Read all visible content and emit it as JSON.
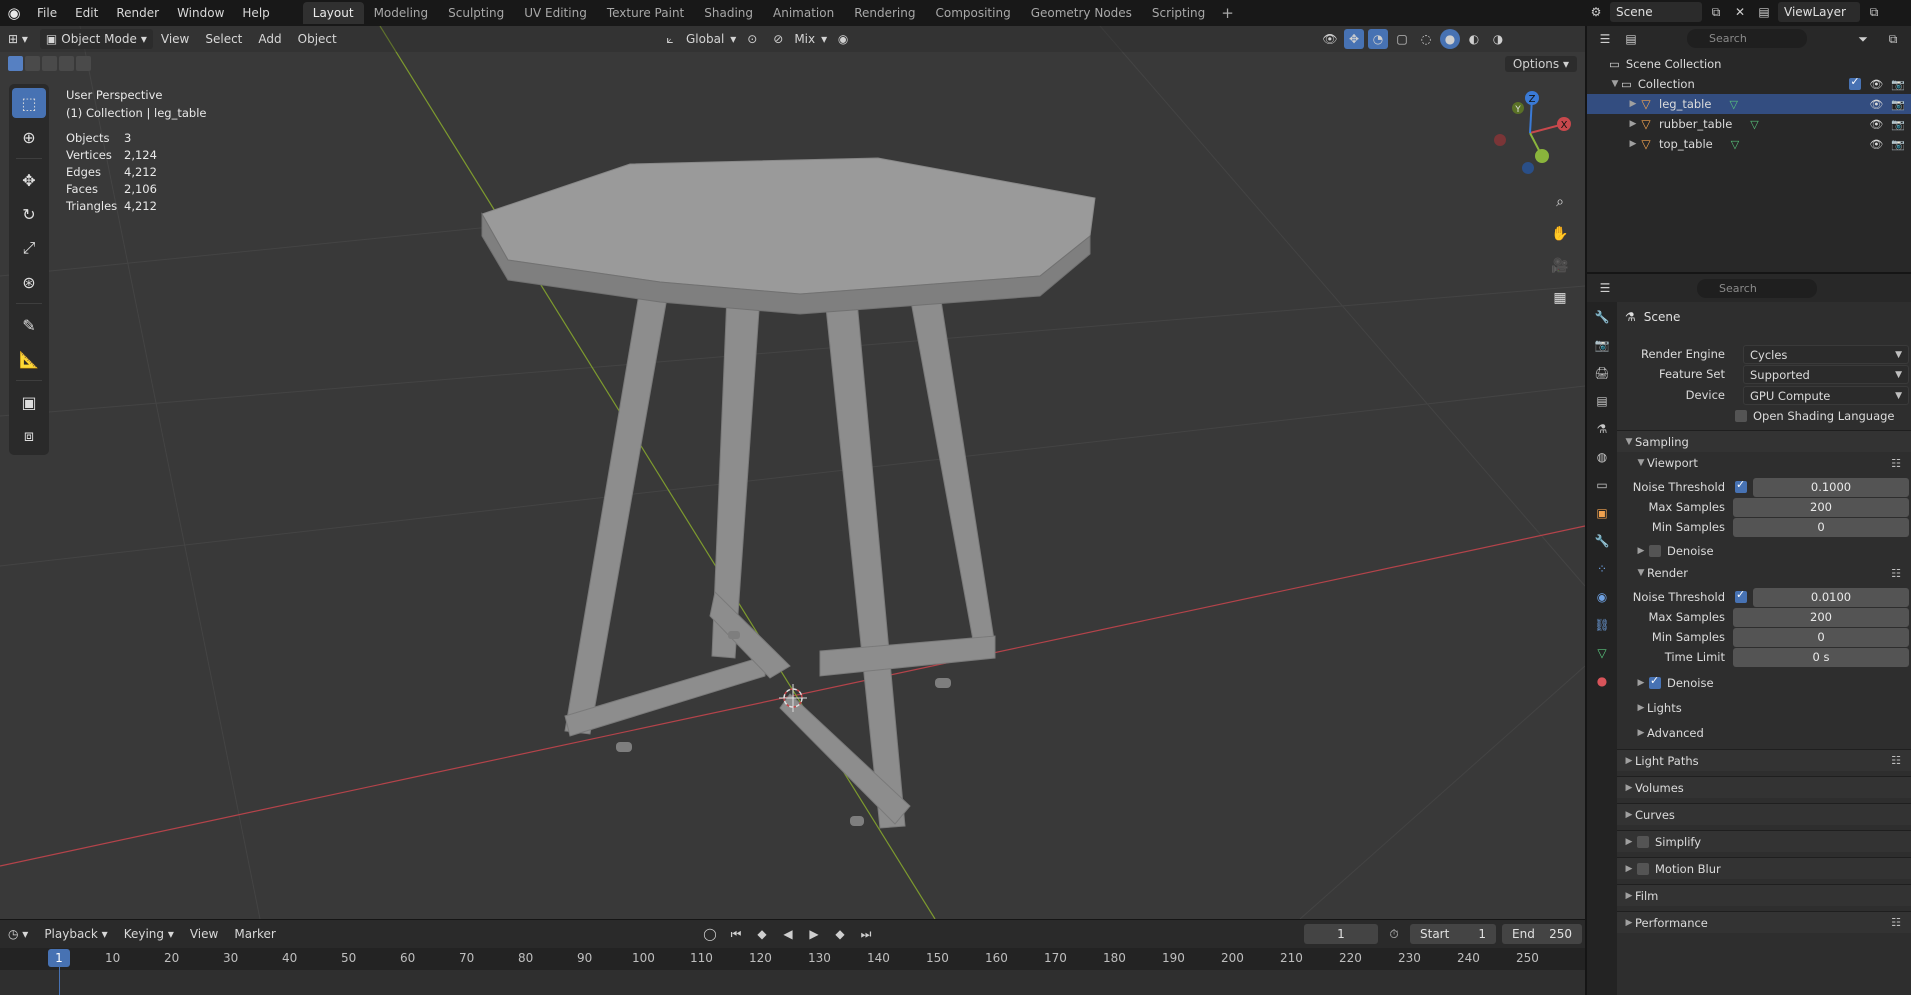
{
  "topbar": {
    "menu": [
      "File",
      "Edit",
      "Render",
      "Window",
      "Help"
    ],
    "workspaces": [
      "Layout",
      "Modeling",
      "Sculpting",
      "UV Editing",
      "Texture Paint",
      "Shading",
      "Animation",
      "Rendering",
      "Compositing",
      "Geometry Nodes",
      "Scripting"
    ],
    "active_workspace": "Layout",
    "add_tab": "+",
    "scene": "Scene",
    "view_layer": "ViewLayer"
  },
  "viewport": {
    "mode": "Object Mode",
    "menu": [
      "View",
      "Select",
      "Add",
      "Object"
    ],
    "transform_orientation": "Global",
    "proportional": "Mix",
    "options": "Options",
    "overlay_title": "User Perspective",
    "overlay_collection": "(1) Collection | leg_table",
    "stats": [
      {
        "label": "Objects",
        "value": "3"
      },
      {
        "label": "Vertices",
        "value": "2,124"
      },
      {
        "label": "Edges",
        "value": "4,212"
      },
      {
        "label": "Faces",
        "value": "2,106"
      },
      {
        "label": "Triangles",
        "value": "4,212"
      }
    ],
    "gizmo": {
      "x": "X",
      "y": "Y",
      "z": "Z"
    }
  },
  "timeline": {
    "menu": [
      "Playback",
      "Keying",
      "View",
      "Marker"
    ],
    "current_frame": "1",
    "start_label": "Start",
    "start": "1",
    "end_label": "End",
    "end": "250",
    "ruler": [
      "10",
      "20",
      "30",
      "40",
      "50",
      "60",
      "70",
      "80",
      "90",
      "100",
      "110",
      "120",
      "130",
      "140",
      "150",
      "160",
      "170",
      "180",
      "190",
      "200",
      "210",
      "220",
      "230",
      "240",
      "250"
    ],
    "cursor": "1"
  },
  "outliner": {
    "search_placeholder": "Search",
    "scene_collection": "Scene Collection",
    "collection": "Collection",
    "objects": [
      "leg_table",
      "rubber_table",
      "top_table"
    ]
  },
  "properties": {
    "search_placeholder": "Search",
    "scene": "Scene",
    "render_engine_label": "Render Engine",
    "render_engine": "Cycles",
    "feature_set_label": "Feature Set",
    "feature_set": "Supported",
    "device_label": "Device",
    "device": "GPU Compute",
    "osl": "Open Shading Language",
    "sampling": "Sampling",
    "viewport": "Viewport",
    "noise_threshold_label": "Noise Threshold",
    "vp_noise_threshold": "0.1000",
    "max_samples_label": "Max Samples",
    "vp_max_samples": "200",
    "min_samples_label": "Min Samples",
    "vp_min_samples": "0",
    "denoise": "Denoise",
    "render": "Render",
    "r_noise_threshold": "0.0100",
    "r_max_samples": "200",
    "r_min_samples": "0",
    "time_limit_label": "Time Limit",
    "time_limit": "0 s",
    "lights": "Lights",
    "advanced": "Advanced",
    "panels": [
      "Light Paths",
      "Volumes",
      "Curves",
      "Simplify",
      "Motion Blur",
      "Film",
      "Performance"
    ]
  },
  "colors": {
    "accent": "#4772b3",
    "object_icon": "#f0a14f",
    "mesh_icon": "#59c57c",
    "x_axis": "#c8484c",
    "y_axis": "#8ab43c",
    "z_axis": "#3a7ad6"
  }
}
